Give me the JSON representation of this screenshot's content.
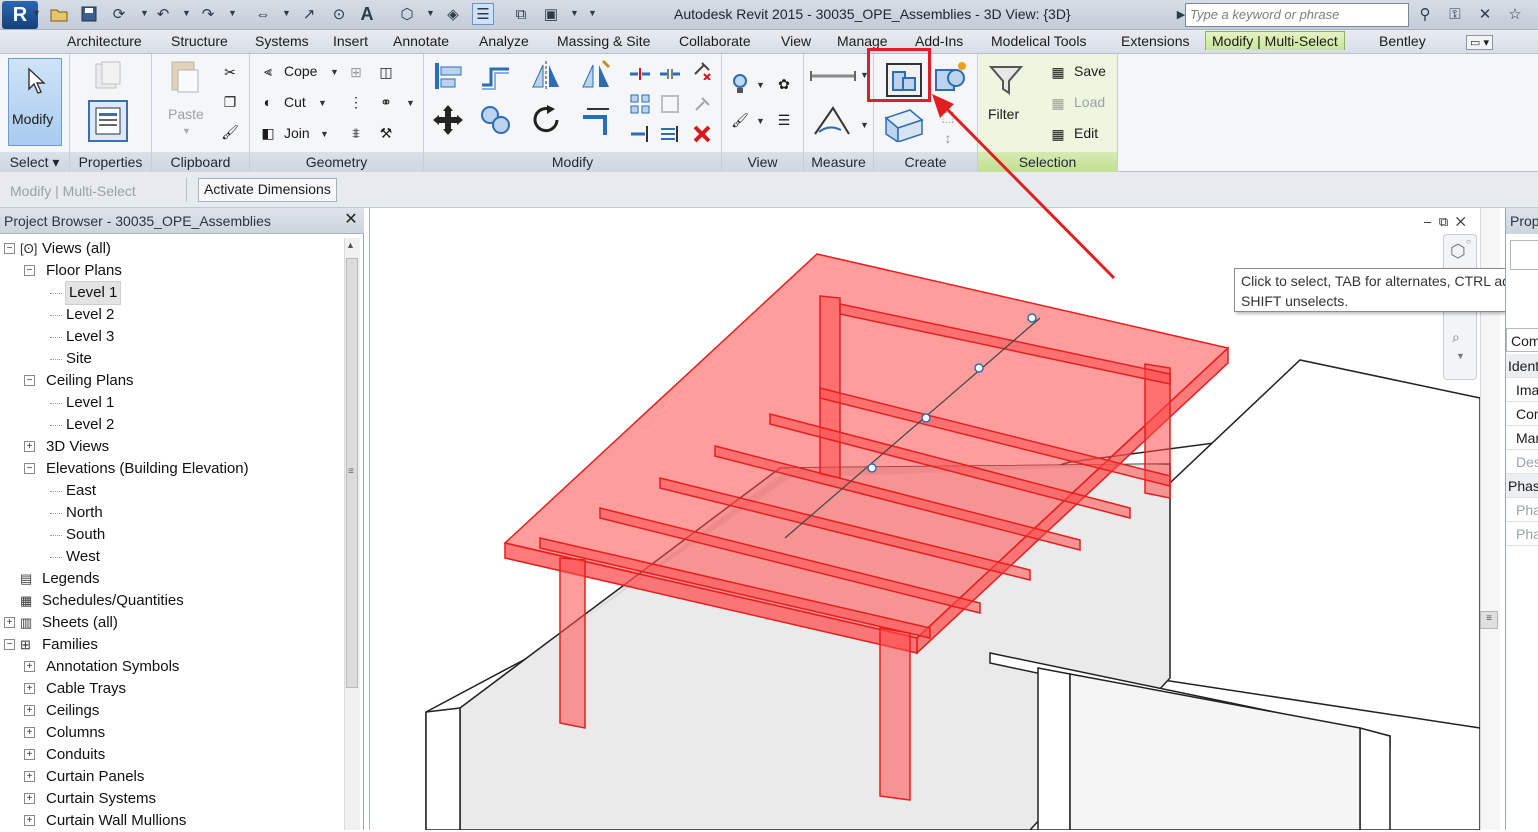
{
  "title_bar": {
    "title": "Autodesk Revit 2015 -    30035_OPE_Assemblies - 3D View: {3D}",
    "search_placeholder": "Type a keyword or phrase"
  },
  "ribbon_tabs": [
    "Architecture",
    "Structure",
    "Systems",
    "Insert",
    "Annotate",
    "Analyze",
    "Massing & Site",
    "Collaborate",
    "View",
    "Manage",
    "Add-Ins",
    "Modelical Tools",
    "Extensions",
    "Modify | Multi-Select",
    "Bentley"
  ],
  "active_tab": "Modify | Multi-Select",
  "ribbon": {
    "modify_label": "Modify",
    "select_label": "Select",
    "properties_label": "Properties",
    "paste_label": "Paste",
    "clipboard_label": "Clipboard",
    "cope_label": "Cope",
    "cut_label": "Cut",
    "join_label": "Join",
    "geometry_label": "Geometry",
    "modify_panel_label": "Modify",
    "view_label": "View",
    "measure_label": "Measure",
    "create_label": "Create",
    "filter_label": "Filter",
    "save_label": "Save",
    "load_label": "Load",
    "edit_label": "Edit",
    "selection_label": "Selection"
  },
  "options_bar": {
    "context_label": "Modify | Multi-Select",
    "activate_dimensions": "Activate Dimensions"
  },
  "project_browser": {
    "title": "Project Browser - 30035_OPE_Assemblies",
    "close": "✕",
    "items": [
      {
        "label": "Views (all)",
        "toggle": "−",
        "icon": "views"
      },
      {
        "label": "Floor Plans",
        "toggle": "−"
      },
      {
        "label": "Level 1",
        "selected": true
      },
      {
        "label": "Level 2"
      },
      {
        "label": "Level 3"
      },
      {
        "label": "Site"
      },
      {
        "label": "Ceiling Plans",
        "toggle": "−"
      },
      {
        "label": "Level 1"
      },
      {
        "label": "Level 2"
      },
      {
        "label": "3D Views",
        "toggle": "+"
      },
      {
        "label": "Elevations (Building Elevation)",
        "toggle": "−"
      },
      {
        "label": "East"
      },
      {
        "label": "North"
      },
      {
        "label": "South"
      },
      {
        "label": "West"
      },
      {
        "label": "Legends",
        "icon": "legend"
      },
      {
        "label": "Schedules/Quantities",
        "icon": "schedule"
      },
      {
        "label": "Sheets (all)",
        "toggle": "+",
        "icon": "sheet"
      },
      {
        "label": "Families",
        "toggle": "−",
        "icon": "family"
      },
      {
        "label": "Annotation Symbols",
        "toggle": "+"
      },
      {
        "label": "Cable Trays",
        "toggle": "+"
      },
      {
        "label": "Ceilings",
        "toggle": "+"
      },
      {
        "label": "Columns",
        "toggle": "+"
      },
      {
        "label": "Conduits",
        "toggle": "+"
      },
      {
        "label": "Curtain Panels",
        "toggle": "+"
      },
      {
        "label": "Curtain Systems",
        "toggle": "+"
      },
      {
        "label": "Curtain Wall Mullions",
        "toggle": "+"
      }
    ]
  },
  "tooltip": {
    "text": "Click to select, TAB for alternates, CTRL adds, SHIFT unselects."
  },
  "properties_panel": {
    "title": "Properties",
    "rows": [
      "Com",
      "Identity Data",
      "Image",
      "Comments",
      "Mark",
      "Description",
      "Phasing",
      "Phase Created",
      "Phase Demolished"
    ]
  },
  "colors": {
    "selection_red": "#ff4d4d",
    "callout_red": "#e02020",
    "active_tab_green": "#c9e59a"
  }
}
